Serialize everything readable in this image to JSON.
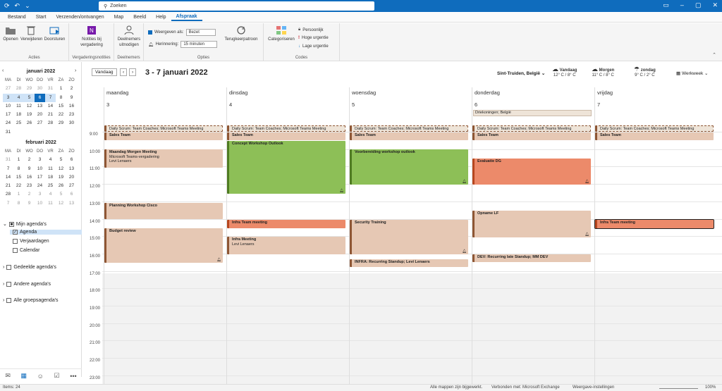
{
  "window": {
    "search_placeholder": "Zoeken"
  },
  "menu": [
    "Bestand",
    "Start",
    "Verzenden/ontvangen",
    "Map",
    "Beeld",
    "Help",
    "Afspraak"
  ],
  "ribbon": {
    "openen": "Openen",
    "verwijderen": "Verwijderen",
    "doorsturen": "Doorsturen",
    "acties": "Acties",
    "notities": "Notities bij vergadering",
    "vergaderingsnotities": "Vergaderingsnotities",
    "deelnemers_uitnodigen": "Deelnemers uitnodigen",
    "deelnemers": "Deelnemers",
    "weergeven_als": "Weergeven als:",
    "weergeven_value": "Bezet",
    "herinnering": "Herinnering:",
    "herinnering_value": "15 minuten",
    "terugkeerpatroon": "Terugkeerpatroon",
    "opties": "Opties",
    "categoriseren": "Categoriseren",
    "persoonlijk": "Persoonlijk",
    "hoge_urgentie": "Hoge urgentie",
    "lage_urgentie": "Lage urgentie",
    "codes": "Codes"
  },
  "mini_cal": {
    "jan": {
      "title": "januari 2022",
      "weekdays": [
        "MA",
        "DI",
        "WO",
        "DO",
        "VR",
        "ZA",
        "ZO"
      ],
      "rows": [
        [
          "27",
          "28",
          "29",
          "30",
          "31",
          "1",
          "2"
        ],
        [
          "3",
          "4",
          "5",
          "6",
          "7",
          "8",
          "9"
        ],
        [
          "10",
          "11",
          "12",
          "13",
          "14",
          "15",
          "16"
        ],
        [
          "17",
          "18",
          "19",
          "20",
          "21",
          "22",
          "23"
        ],
        [
          "24",
          "25",
          "26",
          "27",
          "28",
          "29",
          "30"
        ],
        [
          "31"
        ]
      ]
    },
    "feb": {
      "title": "februari 2022",
      "weekdays": [
        "MA",
        "DI",
        "WO",
        "DO",
        "VR",
        "ZA",
        "ZO"
      ],
      "rows": [
        [
          "31",
          "1",
          "2",
          "3",
          "4",
          "5",
          "6"
        ],
        [
          "7",
          "8",
          "9",
          "10",
          "11",
          "12",
          "13"
        ],
        [
          "14",
          "15",
          "16",
          "17",
          "18",
          "19",
          "20"
        ],
        [
          "21",
          "22",
          "23",
          "24",
          "25",
          "26",
          "27"
        ],
        [
          "28",
          "1",
          "2",
          "3",
          "4",
          "5",
          "6"
        ],
        [
          "7",
          "8",
          "9",
          "10",
          "11",
          "12",
          "13"
        ]
      ]
    }
  },
  "folders": {
    "mijn": "Mijn agenda's",
    "agenda": "Agenda",
    "verjaardagen": "Verjaardagen",
    "calendar": "Calendar",
    "gedeelde": "Gedeelde agenda's",
    "andere": "Andere agenda's",
    "groeps": "Alle groepsagenda's"
  },
  "calendar": {
    "today_btn": "Vandaag",
    "range": "3 - 7 januari 2022",
    "location": "Sint-Truiden, België",
    "weather": [
      {
        "label": "Vandaag",
        "temp": "12° C / 8° C"
      },
      {
        "label": "Morgen",
        "temp": "11° C / 8° C"
      },
      {
        "label": "zondag",
        "temp": "9° C / 2° C"
      }
    ],
    "view": "Werkweek",
    "days": [
      {
        "name": "maandag",
        "num": "3"
      },
      {
        "name": "dinsdag",
        "num": "4"
      },
      {
        "name": "woensdag",
        "num": "5"
      },
      {
        "name": "donderdag",
        "num": "6"
      },
      {
        "name": "vrijdag",
        "num": "7"
      }
    ],
    "allday_event": "Driekoningen; België",
    "hours": [
      "9:00",
      "10:00",
      "11:00",
      "12:00",
      "13:00",
      "14:00",
      "15:00",
      "16:00",
      "17:00",
      "18:00",
      "19:00",
      "20:00",
      "21:00",
      "22:00",
      "23:00"
    ],
    "events": {
      "scrum": "Daily Scrum: Team Coaches; Microsoft Teams Meeting",
      "sales": "Sales Team",
      "mon_morgen_t": "Maandag Morgen Meeting",
      "mon_morgen_l1": "Microsoft Teams-vergadering",
      "mon_morgen_l2": "Levi Lenaers",
      "mon_planning": "Planning Workshop Cisco",
      "mon_budget": "Budget review",
      "tue_concept": "Concept Workshop Outlook",
      "tue_infra": "Infra Team meeting",
      "tue_infram_t": "Infra Meeting",
      "tue_infram_l": "Levi Lenaers",
      "wed_voorb": "Voorbereiding workshop outlook",
      "wed_security": "Security Training",
      "wed_standup": "INFRA: Recurring  Standup; Levi Lenaers",
      "thu_eval": "Evaluatie DG",
      "thu_opname": "Opname LF",
      "thu_dev": "DEV: Recurring late Standup; MM DEV",
      "fri_infra": "Infra Team meeting"
    }
  },
  "status": {
    "items": "Items: 24",
    "folders": "Alle mappen zijn bijgewerkt.",
    "exchange": "Verbonden met: Microsoft Exchange",
    "settings": "Weergave-instellingen",
    "zoom": "100%"
  },
  "colors": {
    "accent": "#0f6cbd",
    "tan": "#e6c8b4",
    "green": "#8dbf57",
    "salmon": "#ec8a6a"
  }
}
